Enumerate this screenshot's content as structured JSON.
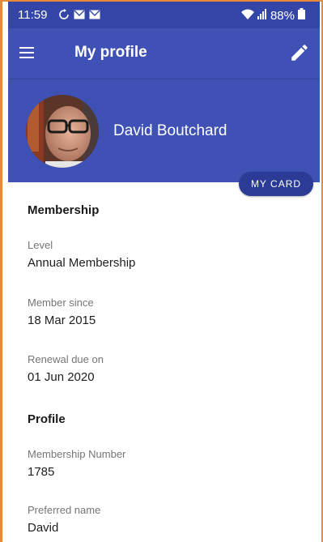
{
  "status_bar": {
    "time": "11:59",
    "battery": "88%",
    "icons": [
      "sync-icon",
      "mail-icon",
      "mail-icon",
      "wifi-icon",
      "signal-icon",
      "battery-icon"
    ]
  },
  "app_bar": {
    "title": "My profile",
    "menu_icon": "hamburger-menu-icon",
    "edit_icon": "pencil-edit-icon"
  },
  "header": {
    "user_name": "David Boutchard",
    "card_button_label": "MY CARD"
  },
  "membership": {
    "section_title": "Membership",
    "fields": [
      {
        "label": "Level",
        "value": "Annual Membership"
      },
      {
        "label": "Member since",
        "value": "18 Mar 2015"
      },
      {
        "label": "Renewal due on",
        "value": "01 Jun 2020"
      }
    ]
  },
  "profile": {
    "section_title": "Profile",
    "fields": [
      {
        "label": "Membership Number",
        "value": "1785"
      },
      {
        "label": "Preferred name",
        "value": "David"
      }
    ]
  },
  "colors": {
    "primary": "#3f51b5",
    "status_bar": "#3346a8",
    "button": "#2c3c96",
    "frame": "#e8893a"
  }
}
